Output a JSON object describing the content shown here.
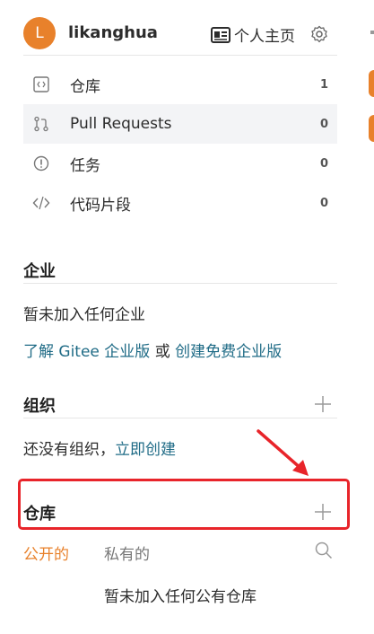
{
  "user": {
    "avatar_initial": "L",
    "name": "likanghua",
    "home_label": "个人主页"
  },
  "nav": [
    {
      "label": "仓库",
      "count": "1",
      "icon": "code-box-icon"
    },
    {
      "label": "Pull Requests",
      "count": "0",
      "icon": "pull-request-icon"
    },
    {
      "label": "任务",
      "count": "0",
      "icon": "issue-icon"
    },
    {
      "label": "代码片段",
      "count": "0",
      "icon": "code-snippet-icon"
    }
  ],
  "enterprise": {
    "title": "企业",
    "empty_text": "暂未加入任何企业",
    "learn_link": "了解 Gitee 企业版",
    "or_text": " 或 ",
    "create_link": "创建免费企业版"
  },
  "org": {
    "title": "组织",
    "empty_text": "还没有组织，",
    "create_link": "立即创建"
  },
  "repos": {
    "title": "仓库",
    "tab_public": "公开的",
    "tab_private": "私有的",
    "empty_text": "暂未加入任何公有仓库"
  },
  "colors": {
    "accent": "#e8812b",
    "link": "#1f6b86",
    "annotation_red": "#e8242a"
  }
}
